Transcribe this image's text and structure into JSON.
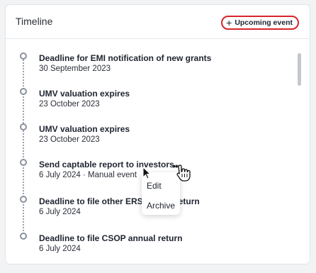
{
  "header": {
    "title": "Timeline",
    "upcoming_button_label": "Upcoming event",
    "plus_icon": "+"
  },
  "timeline": {
    "items": [
      {
        "title": "Deadline for EMI notification of new grants",
        "subtitle": "30 September 2023"
      },
      {
        "title": "UMV valuation expires",
        "subtitle": "23 October 2023"
      },
      {
        "title": "UMV valuation expires",
        "subtitle": "23 October 2023"
      },
      {
        "title": "Send captable report to investors",
        "subtitle": "6 July 2024 · Manual event"
      },
      {
        "title": "Deadline to file other ERS annual return",
        "subtitle": "6 July 2024"
      },
      {
        "title": "Deadline to file CSOP annual return",
        "subtitle": "6 July 2024"
      }
    ]
  },
  "context_menu": {
    "items": [
      "Edit",
      "Archive"
    ]
  },
  "icons": {
    "more": "more-horizontal-icon",
    "plus": "plus-icon"
  },
  "colors": {
    "highlight_border": "#d6262b",
    "text": "#1f2430",
    "rail": "#9aa0ab"
  }
}
